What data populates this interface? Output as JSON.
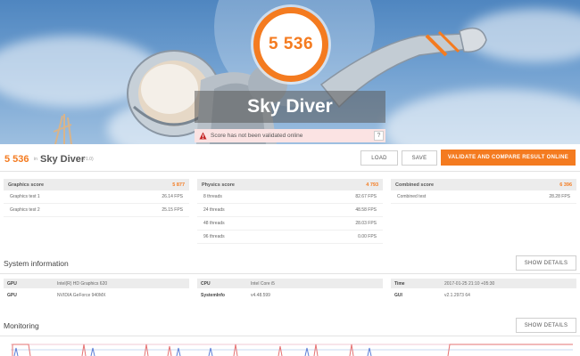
{
  "hero": {
    "score": "5 536",
    "test_name": "Sky Diver",
    "validation_message": "Score has not been validated online",
    "help_label": "?"
  },
  "result": {
    "score": "5 536",
    "in_label": "in",
    "test_name": "Sky Diver",
    "version": "(V1.0)",
    "load_label": "LOAD",
    "save_label": "SAVE",
    "validate_label": "VALIDATE AND COMPARE RESULT ONLINE"
  },
  "graphics": {
    "title": "Graphics score",
    "value": "5 877",
    "rows": [
      {
        "label": "Graphics test 1",
        "value": "26.14 FPS"
      },
      {
        "label": "Graphics test 2",
        "value": "25.15 FPS"
      }
    ]
  },
  "physics": {
    "title": "Physics score",
    "value": "4 793",
    "rows": [
      {
        "label": "8 threads",
        "value": "82.67 FPS"
      },
      {
        "label": "24 threads",
        "value": "48.58 FPS"
      },
      {
        "label": "48 threads",
        "value": "28.03 FPS"
      },
      {
        "label": "96 threads",
        "value": "0.00 FPS"
      }
    ]
  },
  "combined": {
    "title": "Combined score",
    "value": "6 396",
    "rows": [
      {
        "label": "Combined test",
        "value": "28.28 FPS"
      }
    ]
  },
  "system_info": {
    "title": "System information",
    "show_details": "SHOW DETAILS",
    "col1": [
      {
        "key": "GPU",
        "value": "Intel(R) HD Graphics 620"
      },
      {
        "key": "GPU",
        "value": "NVIDIA GeForce 940MX"
      }
    ],
    "col2": [
      {
        "key": "CPU",
        "value": "Intel Core i5"
      },
      {
        "key": "SystemInfo",
        "value": "v4.48.599"
      }
    ],
    "col3": [
      {
        "key": "Time",
        "value": "2017-01-25 21:10 +05:30"
      },
      {
        "key": "GUI",
        "value": "v2.1.2973 64"
      }
    ]
  },
  "monitoring": {
    "title": "Monitoring",
    "show_details": "SHOW DETAILS"
  },
  "colors": {
    "accent": "#f47b20",
    "warning_bg": "#fbe3e3",
    "warning_icon": "#c62828",
    "panel_header": "#ececec"
  },
  "icons": {
    "warning": "warning-icon",
    "help": "help-icon"
  }
}
